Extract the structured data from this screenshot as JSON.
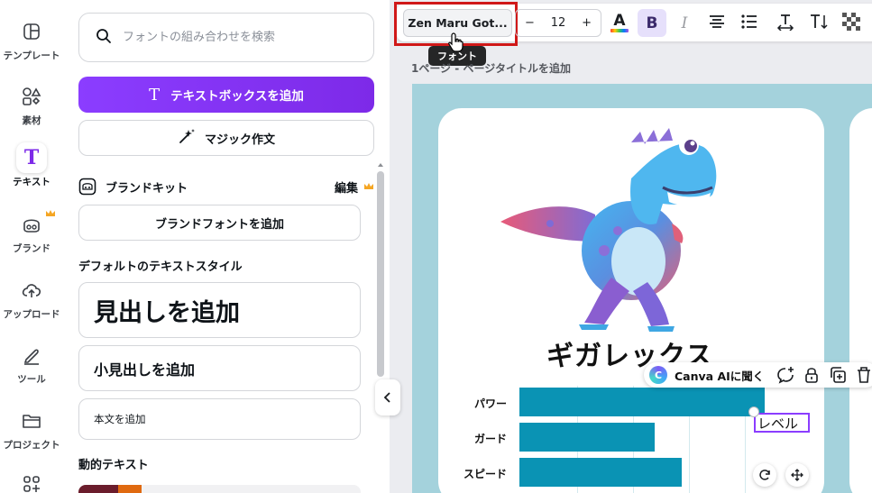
{
  "rail": {
    "items": [
      {
        "label": "テンプレート",
        "icon": "template-icon"
      },
      {
        "label": "素材",
        "icon": "elements-icon"
      },
      {
        "label": "テキスト",
        "icon": "text-icon",
        "active": true
      },
      {
        "label": "ブランド",
        "icon": "brand-icon"
      },
      {
        "label": "アップロード",
        "icon": "upload-icon"
      },
      {
        "label": "ツール",
        "icon": "tools-icon"
      },
      {
        "label": "プロジェクト",
        "icon": "folder-icon"
      },
      {
        "label": "",
        "icon": "apps-icon"
      }
    ]
  },
  "panel": {
    "search_placeholder": "フォントの組み合わせを検索",
    "add_textbox": "テキストボックスを追加",
    "magic_write": "マジック作文",
    "brand_kit": "ブランドキット",
    "edit": "編集",
    "add_brand_font": "ブランドフォントを追加",
    "default_styles_title": "デフォルトのテキストスタイル",
    "add_heading": "見出しを追加",
    "add_subheading": "小見出しを追加",
    "add_body": "本文を追加",
    "dynamic_text_title": "動的テキスト"
  },
  "toolbar": {
    "font_name": "Zen Maru Got...",
    "font_size": "12",
    "minus": "−",
    "plus": "+",
    "bold": "B",
    "italic": "I",
    "tooltip": "フォント"
  },
  "page": {
    "label": "1ページ - ページタイトルを追加"
  },
  "card": {
    "title": "ギガレックス",
    "ai_button": "Canva AIに聞く",
    "selected_text": "レベル"
  },
  "chart_data": {
    "type": "bar",
    "orientation": "horizontal",
    "categories": [
      "パワー",
      "ガード",
      "スピード"
    ],
    "values": [
      100,
      55,
      66
    ],
    "title": "",
    "xlabel": "",
    "ylabel": ""
  },
  "colors": {
    "accent": "#8b3dff",
    "bar": "#0a93b4",
    "canvas_bg": "#a4d2dc",
    "highlight": "#d01818"
  }
}
